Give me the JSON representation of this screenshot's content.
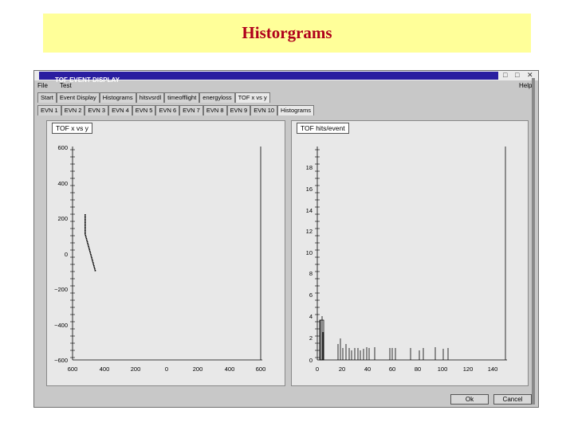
{
  "slide_title": "Historgrams",
  "window": {
    "title": "TOF EVENT DISPLAY",
    "menu": {
      "file": "File",
      "test": "Test",
      "help": "Help"
    }
  },
  "tabs_row1": [
    "Start",
    "Event Display",
    "Histograms",
    "hitsvsrdl",
    "timeofflight",
    "energyloss",
    "TOF x vs y"
  ],
  "tabs_row2": [
    "EVN 1",
    "EVN 2",
    "EVN 3",
    "EVN 4",
    "EVN 5",
    "EVN 6",
    "EVN 7",
    "EVN 8",
    "EVN 9",
    "EVN 10",
    "Histograms"
  ],
  "left_plot": {
    "title": "TOF x vs y",
    "y_ticks": [
      "600",
      "400",
      "200",
      "0",
      "−200",
      "−400",
      "−600"
    ],
    "x_ticks": [
      "600",
      "400",
      "200",
      "0",
      "200",
      "400",
      "600"
    ]
  },
  "right_plot": {
    "title": "TOF hits/event",
    "y_ticks": [
      "18",
      "16",
      "14",
      "12",
      "10",
      "8",
      "6",
      "4",
      "2",
      "0"
    ],
    "x_ticks": [
      "0",
      "20",
      "40",
      "60",
      "80",
      "100",
      "120",
      "140"
    ]
  },
  "buttons": {
    "ok": "Ok",
    "cancel": "Cancel"
  }
}
